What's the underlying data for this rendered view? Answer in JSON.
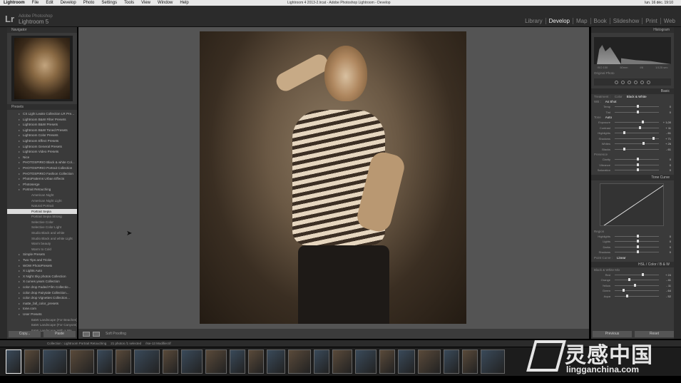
{
  "menubar": {
    "items": [
      "Lightroom",
      "File",
      "Edit",
      "Develop",
      "Photo",
      "Settings",
      "Tools",
      "View",
      "Window",
      "Help"
    ],
    "window_title": "Lightroom 4 2013-2.lrcat - Adobe Photoshop Lightroom - Develop",
    "clock": "lun. 16 déc. 19:10"
  },
  "app": {
    "logo": "Lr",
    "vendor": "Adobe Photoshop",
    "name": "Lightroom 5"
  },
  "modules": [
    "Library",
    "Develop",
    "Map",
    "Book",
    "Slideshow",
    "Print",
    "Web"
  ],
  "active_module": "Develop",
  "left": {
    "navigator_label": "Navigator",
    "presets_label": "Presets",
    "presets": [
      {
        "label": "CS Light Leaks Collection LR Pre...",
        "type": "folder"
      },
      {
        "label": "Lightroom B&W Filter Presets",
        "type": "folder"
      },
      {
        "label": "Lightroom B&W Presets",
        "type": "folder"
      },
      {
        "label": "Lightroom B&W Toned Presets",
        "type": "folder"
      },
      {
        "label": "Lightroom Color Presets",
        "type": "folder"
      },
      {
        "label": "Lightroom Effect Presets",
        "type": "folder"
      },
      {
        "label": "Lightroom General Presets",
        "type": "folder"
      },
      {
        "label": "Lightroom Video Presets",
        "type": "folder"
      },
      {
        "label": "Nice",
        "type": "folder"
      },
      {
        "label": "PHOTOSPIRIO Black & white Col...",
        "type": "folder"
      },
      {
        "label": "PHOTOSPIRIO Portrait Collection",
        "type": "folder"
      },
      {
        "label": "PHOTOSPIRIO Fashion Collection",
        "type": "folder"
      },
      {
        "label": "PhotoPatterns Urban Effects",
        "type": "folder"
      },
      {
        "label": "Photoserge",
        "type": "folder"
      },
      {
        "label": "Portrait Retouching",
        "type": "folder"
      },
      {
        "label": "American Night",
        "type": "sub"
      },
      {
        "label": "American Night Light",
        "type": "sub"
      },
      {
        "label": "Natural Portrait",
        "type": "sub"
      },
      {
        "label": "Portrait Sepia",
        "type": "sub",
        "selected": true
      },
      {
        "label": "Portrait Sepia Strong",
        "type": "sub"
      },
      {
        "label": "Selective Color",
        "type": "sub"
      },
      {
        "label": "Selective Color Light",
        "type": "sub"
      },
      {
        "label": "Studio Black and white",
        "type": "sub"
      },
      {
        "label": "Studio Black and white Light",
        "type": "sub"
      },
      {
        "label": "Warm beauty",
        "type": "sub"
      },
      {
        "label": "Warm to Cold",
        "type": "sub"
      },
      {
        "label": "Simple Presets",
        "type": "folder"
      },
      {
        "label": "Two Tips and Tricks",
        "type": "folder"
      },
      {
        "label": "WOW PhotoPresets",
        "type": "folder"
      },
      {
        "label": "X Lights Auto",
        "type": "folder"
      },
      {
        "label": "X Night Sky photos Collection",
        "type": "folder"
      },
      {
        "label": "X curves years Collection",
        "type": "folder"
      },
      {
        "label": "color drop Faded Film Collectio...",
        "type": "folder"
      },
      {
        "label": "color drop Fairytale Collection...",
        "type": "folder"
      },
      {
        "label": "color drop Vignettes Collection...",
        "type": "folder"
      },
      {
        "label": "matte_fall_color_presets",
        "type": "folder"
      },
      {
        "label": "tone.com",
        "type": "folder"
      },
      {
        "label": "User Presets",
        "type": "folder"
      },
      {
        "label": "B&W Landscape (For Beaches)",
        "type": "sub"
      },
      {
        "label": "B&W Landscape (For Canyons)",
        "type": "sub"
      },
      {
        "label": "B&W Landscape With a Wa...",
        "type": "sub"
      }
    ],
    "copy_label": "Copy...",
    "paste_label": "Paste"
  },
  "toolbar": {
    "soft_proofing": "Soft Proofing"
  },
  "right": {
    "histogram_label": "Histogram",
    "hist_values": [
      "ISO 100",
      "50mm",
      "f/8",
      "1/125 sec"
    ],
    "original_photo": "Original Photo",
    "basic_label": "Basic",
    "treatment_label": "Treatment :",
    "treatment_color": "Color",
    "treatment_bw": "Black & White",
    "wb_label": "WB :",
    "wb_value": "As Shot",
    "tone_label": "Tone",
    "auto_label": "Auto",
    "presence_label": "Presence",
    "tone_curve_label": "Tone Curve",
    "region_label": "Region",
    "point_curve_label": "Point Curve :",
    "point_curve_value": "Linear",
    "hsl_label": "HSL / Color / B & W",
    "bw_mix_label": "Black & White Mix",
    "basic_sliders": [
      {
        "label": "Temp",
        "value": "0",
        "pos": 0.5
      },
      {
        "label": "Tint",
        "value": "0",
        "pos": 0.5
      },
      {
        "label": "Exposure",
        "value": "+ 1,00",
        "pos": 0.62
      },
      {
        "label": "Contrast",
        "value": "+ 11",
        "pos": 0.55
      },
      {
        "label": "Highlights",
        "value": "- 61",
        "pos": 0.2
      },
      {
        "label": "Shadows",
        "value": "+ 71",
        "pos": 0.85
      },
      {
        "label": "Whites",
        "value": "+ 26",
        "pos": 0.63
      },
      {
        "label": "Blacks",
        "value": "- 61",
        "pos": 0.2
      },
      {
        "label": "Clarity",
        "value": "0",
        "pos": 0.5
      },
      {
        "label": "Vibrance",
        "value": "0",
        "pos": 0.5
      },
      {
        "label": "Saturation",
        "value": "0",
        "pos": 0.5
      }
    ],
    "region_sliders": [
      {
        "label": "Highlights",
        "value": "0",
        "pos": 0.5
      },
      {
        "label": "Lights",
        "value": "0",
        "pos": 0.5
      },
      {
        "label": "Darks",
        "value": "0",
        "pos": 0.5
      },
      {
        "label": "Shadows",
        "value": "0",
        "pos": 0.5
      }
    ],
    "bw_sliders": [
      {
        "label": "Red",
        "value": "+ 24",
        "pos": 0.62
      },
      {
        "label": "Orange",
        "value": "- 41",
        "pos": 0.3
      },
      {
        "label": "Yellow",
        "value": "- 11",
        "pos": 0.44
      },
      {
        "label": "Green",
        "value": "- 64",
        "pos": 0.18
      },
      {
        "label": "Aqua",
        "value": "- 52",
        "pos": 0.25
      }
    ],
    "previous_label": "Previous",
    "reset_label": "Reset"
  },
  "filmbar": {
    "source": "Collection : Lightroom Portrait Retouching",
    "count": "21 photos /1 selected",
    "file": "/Ise-13 Modifier.tif"
  },
  "watermark": {
    "cn": "灵感中国",
    "en": "lingganchina.com"
  }
}
